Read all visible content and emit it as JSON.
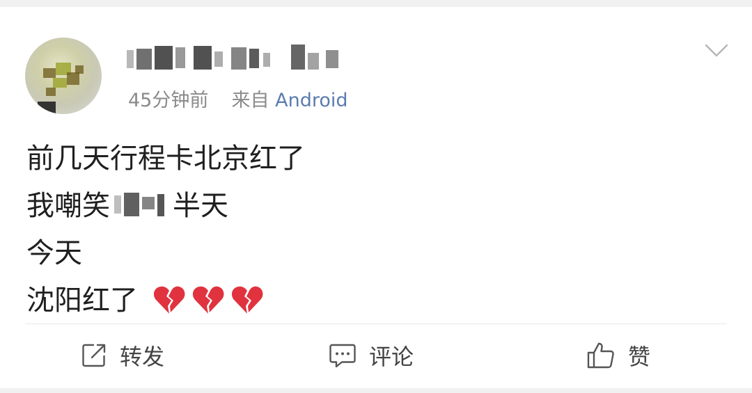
{
  "post": {
    "time": "45分钟前",
    "source_prefix": "来自",
    "source": "Android",
    "lines": [
      "前几天行程卡北京红了",
      "我嘲笑",
      "半天",
      "今天",
      "沈阳红了"
    ],
    "emoji_icon": "broken-heart-icon",
    "emoji_count": 3
  },
  "actions": {
    "repost_label": "转发",
    "comment_label": "评论",
    "like_label": "赞"
  },
  "colors": {
    "link": "#5b7cb0",
    "meta": "#8a8a8a",
    "text": "#1f1f1f",
    "heart": "#e0333f"
  }
}
